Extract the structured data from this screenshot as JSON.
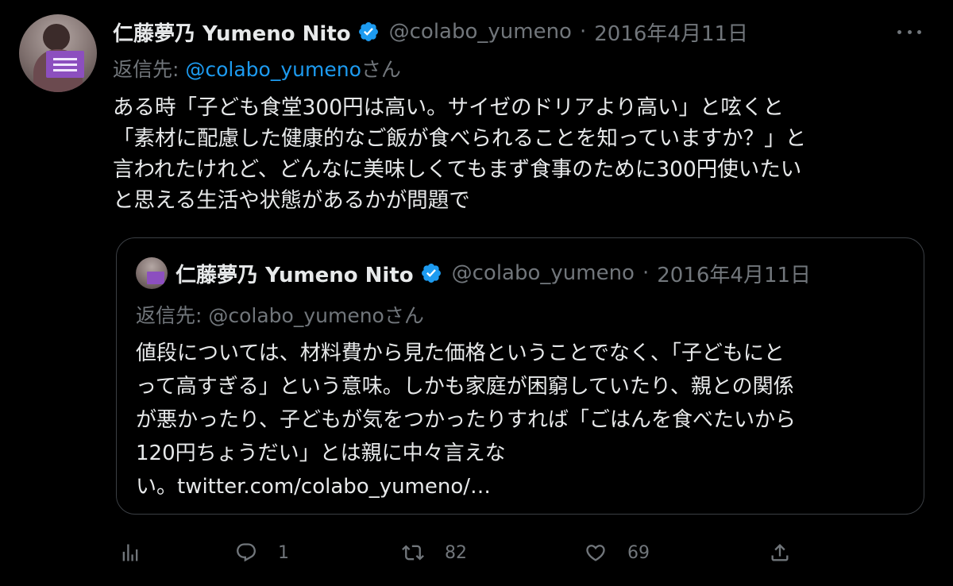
{
  "tweet": {
    "author_name": "仁藤夢乃 Yumeno Nito",
    "handle": "@colabo_yumeno",
    "separator": "·",
    "date": "2016年4月11日",
    "replying_prefix": "返信先: ",
    "replying_handle": "@colabo_yumeno",
    "replying_suffix": "さん",
    "lines": [
      "ある時「子ども食堂300円は高い。サイゼのドリアより高い」と呟くと",
      "「素材に配慮した健康的なご飯が食べられることを知っていますか？」と",
      "言われたけれど、どんなに美味しくてもまず食事のために300円使いたい",
      "と思える生活や状態があるかが問題で"
    ]
  },
  "quote": {
    "author_name": "仁藤夢乃 Yumeno Nito",
    "handle": "@colabo_yumeno",
    "separator": "·",
    "date": "2016年4月11日",
    "replying_text": "返信先: @colabo_yumenoさん",
    "lines": [
      "値段については、材料費から見た価格ということでなく、「子どもにと",
      "って高すぎる」という意味。しかも家庭が困窮していたり、親との関係",
      "が悪かったり、子どもが気をつかったりすれば「ごはんを食べたいから",
      "120円ちょうだい」とは親に中々言えな",
      "い。twitter.com/colabo_yumeno/…"
    ]
  },
  "actions": {
    "analytics_icon": "analytics-icon",
    "reply_icon": "reply-icon",
    "reply_count": "1",
    "retweet_icon": "retweet-icon",
    "retweet_count": "82",
    "like_icon": "like-icon",
    "like_count": "69",
    "share_icon": "share-icon"
  },
  "colors": {
    "background": "#000000",
    "text": "#e7e9ea",
    "muted": "#71767b",
    "link": "#1d9bf0",
    "verified": "#1d9bf0",
    "border": "#3b3f44"
  }
}
